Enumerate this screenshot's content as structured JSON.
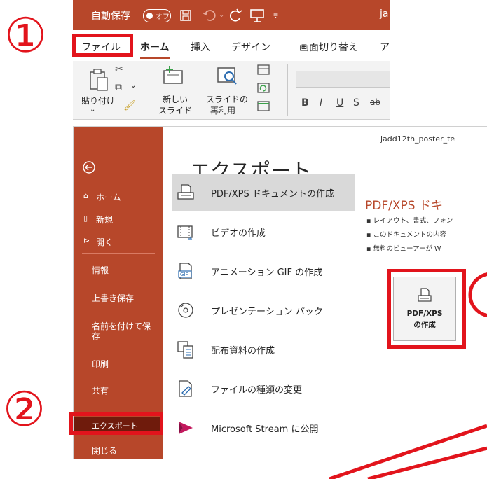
{
  "steps": {
    "one": "①",
    "two": "②"
  },
  "ribbon": {
    "autosave_label": "自動保存",
    "autosave_state": "オフ",
    "title_fragment": "ja",
    "tabs": [
      "ファイル",
      "ホーム",
      "挿入",
      "デザイン",
      "画面切り替え",
      "ア"
    ],
    "paste_label": "貼り付け",
    "new_slide_label_1": "新しい",
    "new_slide_label_2": "スライド",
    "reuse_label_1": "スライドの",
    "reuse_label_2": "再利用",
    "format_buttons": [
      "B",
      "I",
      "U",
      "S",
      "ab"
    ]
  },
  "backstage": {
    "doc_name": "jadd12th_poster_te",
    "nav": {
      "home": "ホーム",
      "new": "新規",
      "open": "開く",
      "info": "情報",
      "save": "上書き保存",
      "save_as_1": "名前を付けて保",
      "save_as_2": "存",
      "print": "印刷",
      "share": "共有",
      "export": "エクスポート",
      "close": "閉じる"
    },
    "heading": "エクスポート",
    "options": [
      "PDF/XPS ドキュメントの作成",
      "ビデオの作成",
      "アニメーション GIF の作成",
      "プレゼンテーション パック",
      "配布資料の作成",
      "ファイルの種類の変更",
      "Microsoft Stream に公開"
    ],
    "right_title": "PDF/XPS ドキ",
    "bullets": [
      "レイアウト、書式、フォン",
      "このドキュメントの内容",
      "無料のビューアーが W"
    ],
    "create_button_1": "PDF/XPS",
    "create_button_2": "の作成",
    "gif_badge": "GIF"
  },
  "colors": {
    "accent": "#b7472a",
    "highlight": "#e2141c",
    "selected_nav": "#6f1b0c"
  }
}
